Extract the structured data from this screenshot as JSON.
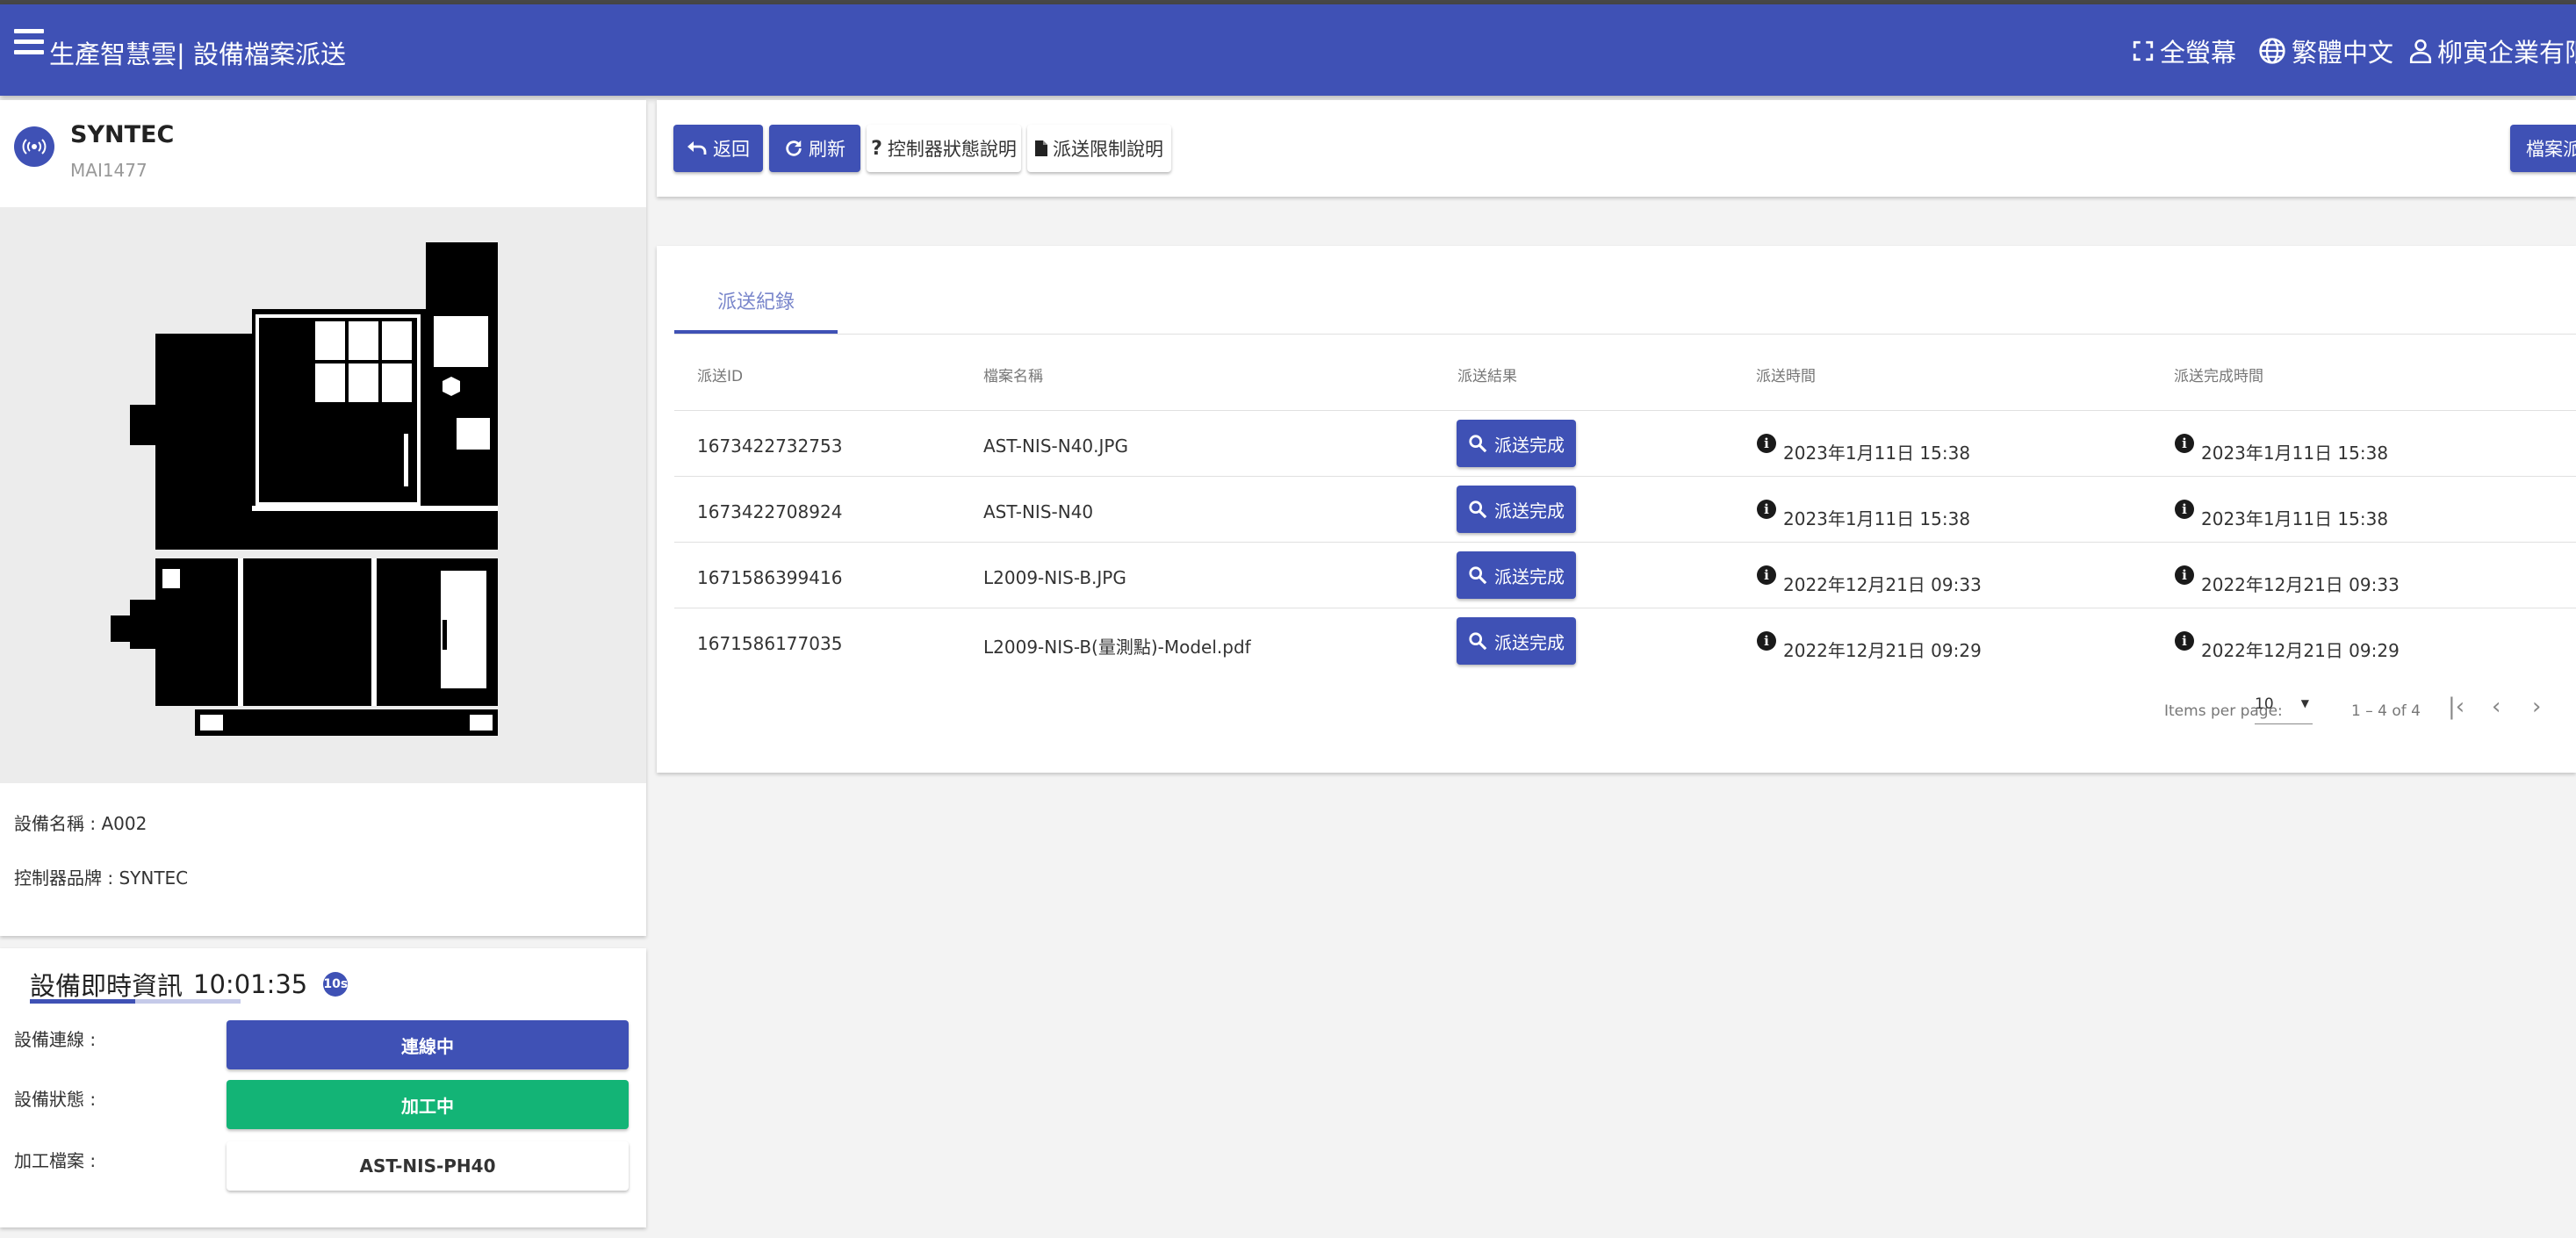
{
  "app": {
    "title": "生產智慧雲| 設備檔案派送",
    "actions": {
      "fullscreen": "全螢幕",
      "language": "繁體中文",
      "user": "柳寅企業有限公"
    }
  },
  "device": {
    "brand": "SYNTEC",
    "model": "MAI1477",
    "name_label": "設備名稱 : A002",
    "controller_label": "控制器品牌 : SYNTEC"
  },
  "realtime": {
    "title": "設備即時資訊",
    "time": "10:01:35",
    "badge": "10s",
    "rows": [
      {
        "label": "設備連線 :",
        "value": "連線中",
        "color": "#3f51b5"
      },
      {
        "label": "設備狀態 :",
        "value": "加工中",
        "color": "#13b476"
      },
      {
        "label": "加工檔案 :",
        "value": "AST-NIS-PH40",
        "color": "#ffffff"
      }
    ]
  },
  "toolbar": {
    "back": "返回",
    "refresh": "刷新",
    "controller_status_help": "控制器狀態說明",
    "dispatch_limit_help": "派送限制說明",
    "file_dispatch": "檔案派送"
  },
  "records": {
    "tab": "派送紀錄",
    "columns": [
      "派送ID",
      "檔案名稱",
      "派送結果",
      "派送時間",
      "派送完成時間"
    ],
    "rows": [
      {
        "id": "1673422732753",
        "file": "AST-NIS-N40.JPG",
        "result": "派送完成",
        "sent": "2023年1月11日 15:38",
        "done": "2023年1月11日 15:38"
      },
      {
        "id": "1673422708924",
        "file": "AST-NIS-N40",
        "result": "派送完成",
        "sent": "2023年1月11日 15:38",
        "done": "2023年1月11日 15:38"
      },
      {
        "id": "1671586399416",
        "file": "L2009-NIS-B.JPG",
        "result": "派送完成",
        "sent": "2022年12月21日 09:33",
        "done": "2022年12月21日 09:33"
      },
      {
        "id": "1671586177035",
        "file": "L2009-NIS-B(量測點)-Model.pdf",
        "result": "派送完成",
        "sent": "2022年12月21日 09:29",
        "done": "2022年12月21日 09:29"
      }
    ],
    "pager": {
      "items_per_page_label": "Items per page:",
      "page_size": "10",
      "range": "1 – 4 of 4"
    }
  },
  "colors": {
    "primary": "#3f51b5",
    "success": "#13b476"
  }
}
